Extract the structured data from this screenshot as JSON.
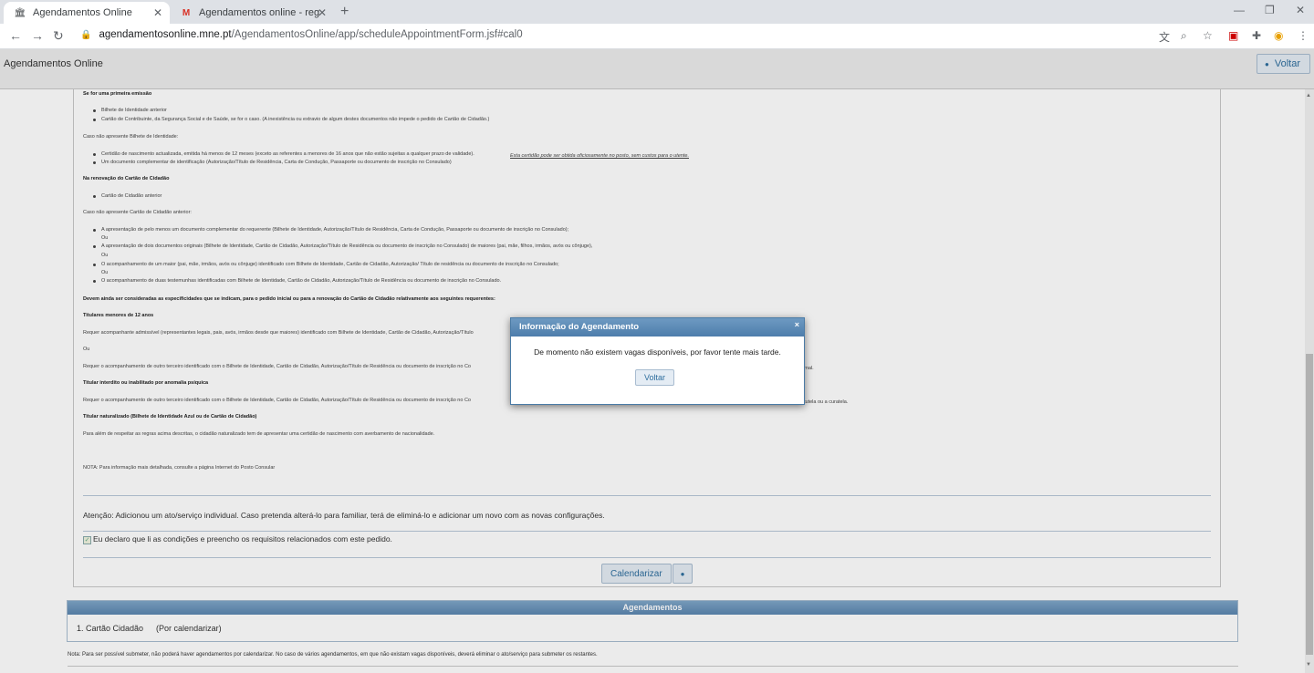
{
  "browser": {
    "tabs": [
      {
        "label": "Agendamentos Online",
        "icon": "crest-icon"
      },
      {
        "label": "Agendamentos online - registo c",
        "icon": "gmail-icon"
      }
    ],
    "new_tab": "+",
    "url_host": "agendamentosonline.mne.pt",
    "url_path": "/AgendamentosOnline/app/scheduleAppointmentForm.jsf#cal0"
  },
  "app": {
    "title": "Agendamentos Online",
    "voltar_label": "Voltar"
  },
  "doc": {
    "lines": [
      {
        "text": "Se for uma primeira emissão",
        "kind": "b"
      },
      {
        "text": "Bilhete de Identidade anterior",
        "kind": "li"
      },
      {
        "text": "Cartão de Contribuinte, da Segurança Social e de Saúde, se for o caso. (A inexistência ou extravio de algum destes documentos não impede o pedido de Cartão de Cidadão.)",
        "kind": "li"
      },
      {
        "text": "Caso não apresente Bilhete de Identidade:",
        "kind": "p"
      },
      {
        "text": "Certidão de nascimento actualizada, emitida há menos de 12 meses (exceto as referentes a menores de 16 anos que não estão sujeitas a qualquer prazo de validade).",
        "kind": "li"
      },
      {
        "text": "Um documento complementar de identificação (Autorização/Título de Residência, Carta de Condução, Passaporte ou documento de inscrição no Consulado)",
        "kind": "li"
      },
      {
        "text": "Na renovação do Cartão de Cidadão",
        "kind": "b"
      },
      {
        "text": "Cartão de Cidadão anterior",
        "kind": "li"
      },
      {
        "text": "Caso não apresente Cartão de Cidadão anterior:",
        "kind": "p"
      },
      {
        "text": "A apresentação de pelo menos um documento complementar do requerente (Bilhete de Identidade, Autorização/Título de Residência, Carta de Condução, Passaporte ou documento de inscrição no Consulado);",
        "kind": "li"
      },
      {
        "text": "Ou",
        "kind": "ou"
      },
      {
        "text": "A apresentação de dois documentos originais (Bilhete de Identidade, Cartão de Cidadão, Autorização/Título de Residência ou documento de inscrição no Consulado) de maiores (pai, mãe, filhos, irmãos, avós ou cônjuge),",
        "kind": "li"
      },
      {
        "text": "Ou",
        "kind": "ou"
      },
      {
        "text": "O acompanhamento de um maior (pai, mãe, irmãos, avós ou cônjuge) identificado com Bilhete de Identidade, Cartão de Cidadão, Autorização/ Título de residência ou documento de inscrição no Consulado;",
        "kind": "li"
      },
      {
        "text": "Ou",
        "kind": "ou"
      },
      {
        "text": "O acompanhamento de duas testemunhas identificadas com Bilhete de Identidade, Cartão de Cidadão, Autorização/Título de Residência ou documento de inscrição no Consulado.",
        "kind": "li"
      },
      {
        "text": "Devem ainda ser consideradas as especificidades que se indicam, para o pedido inicial ou para a renovação do Cartão de Cidadão relativamente aos seguintes requerentes:",
        "kind": "b"
      },
      {
        "text": "Titulares menores de 12 anos",
        "kind": "b"
      },
      {
        "text": "Requer acompanhante admissível (representantes legais, pais, avós, irmãos desde que maiores) identificado com Bilhete de Identidade, Cartão de Cidadão, Autorização/Título",
        "kind": "p"
      },
      {
        "text": "Ou",
        "kind": "p"
      },
      {
        "text": "Requer o acompanhamento de outro terceiro identificado com o Bilhete de Identidade, Cartão de Cidadão, Autorização/Título de Residência ou documento de inscrição no Co",
        "kind": "p"
      },
      {
        "text": "Titular interdito ou inabilitado por anomalia psíquica",
        "kind": "b"
      },
      {
        "text": "Requer o acompanhamento de outro terceiro identificado com o Bilhete de Identidade, Cartão de Cidadão, Autorização/Título de Residência ou documento de inscrição no Co",
        "kind": "p"
      },
      {
        "text": "Titular naturalizado (Bilhete de Identidade Azul ou de Cartão de Cidadão)",
        "kind": "b"
      },
      {
        "text": "Para além de respeitar as regras acima descritas, o cidadão naturalizado tem de apresentar uma certidão de nascimento com averbamento de nacionalidade.",
        "kind": "p"
      },
      {
        "text": "NOTA: Para informação mais detalhada, consulte a página Internet do Posto Consular",
        "kind": "p"
      }
    ],
    "certidao_note": "Esta certidão pode ser obtida oficiosamente no posto, sem custos para o utente.",
    "right_frag_1": "rnal.",
    "right_frag_2": "tutela ou a curatela."
  },
  "form": {
    "atencao": "Atenção: Adicionou um ato/serviço individual. Caso pretenda alterá-lo para familiar, terá de eliminá-lo e adicionar um novo com as novas configurações.",
    "declaro": "Eu declaro que li as condições e preencho os requisitos relacionados com este pedido.",
    "calendarizar_label": "Calendarizar"
  },
  "agendamentos": {
    "header": "Agendamentos",
    "item": "1. Cartão Cidadão",
    "status": "(Por calendarizar)",
    "nota": "Nota: Para ser possível submeter, não poderá haver agendamentos por calendarizar. No caso de vários agendamentos, em que não existam vagas disponíveis, deverá eliminar o ato/serviço para submeter os restantes."
  },
  "dialog": {
    "title": "Informação do Agendamento",
    "message": "De momento não existem vagas disponíveis, por favor tente mais tarde.",
    "button": "Voltar",
    "close": "×"
  }
}
